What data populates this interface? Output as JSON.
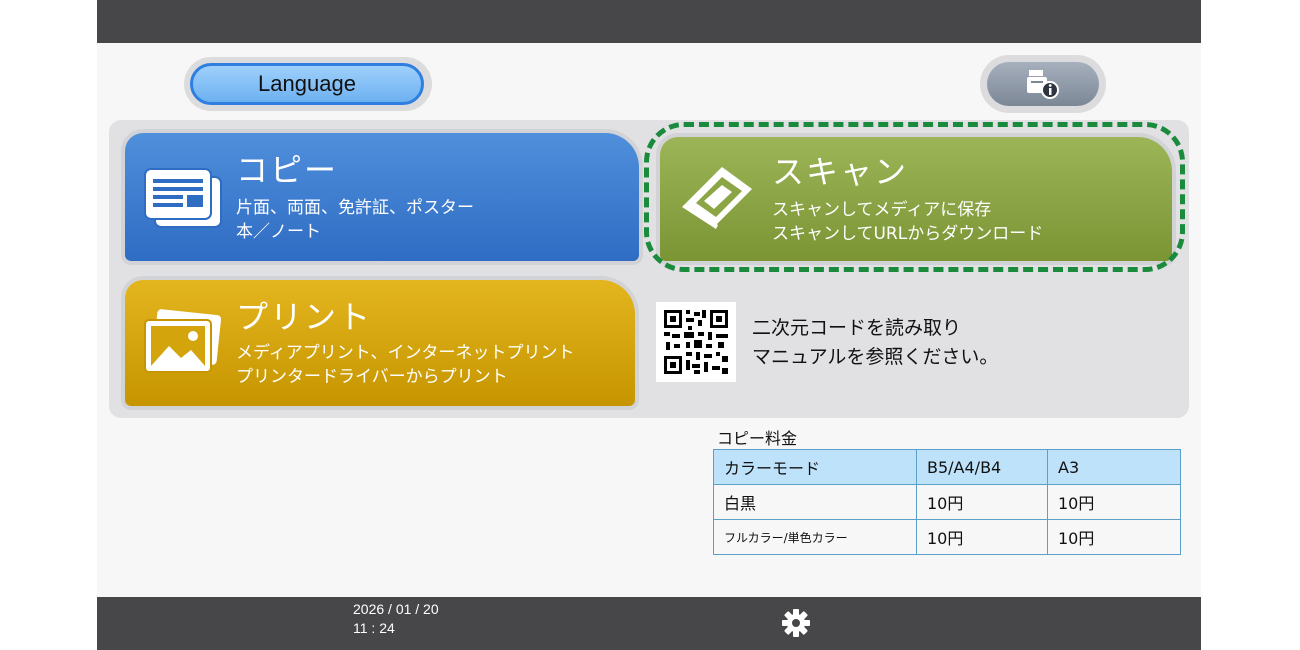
{
  "header": {
    "language_label": "Language"
  },
  "tiles": {
    "copy": {
      "title": "コピー",
      "line1": "片面、両面、免許証、ポスター",
      "line2": "本／ノート"
    },
    "scan": {
      "title": "スキャン",
      "line1": "スキャンしてメディアに保存",
      "line2": "スキャンしてURLからダウンロード"
    },
    "print": {
      "title": "プリント",
      "line1": "メディアプリント、インターネットプリント",
      "line2": "プリンタードライバーからプリント"
    }
  },
  "qr": {
    "line1": "二次元コードを読み取り",
    "line2": "マニュアルを参照ください。"
  },
  "fees": {
    "title": "コピー料金",
    "headers": [
      "カラーモード",
      "B5/A4/B4",
      "A3"
    ],
    "rows": [
      [
        "白黒",
        "10円",
        "10円"
      ],
      [
        "フルカラー/単色カラー",
        "10円",
        "10円"
      ]
    ]
  },
  "footer": {
    "date": "2026 / 01 / 20",
    "time": "11 : 24"
  },
  "colors": {
    "copy": "#3f7fd3",
    "scan": "#8ca545",
    "print": "#d4a40c",
    "highlight": "#1a8a3c",
    "bar": "#47474a"
  },
  "icons": {
    "info": "machine-info-icon",
    "settings": "gear-icon",
    "copy": "document-stack-icon",
    "scan": "scanner-icon",
    "print": "photo-icon"
  }
}
